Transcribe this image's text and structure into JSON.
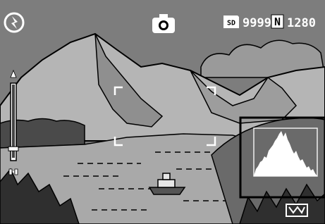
{
  "status_bar": {
    "flash_mode_icon": "flash-off-icon",
    "mode_icon": "camera-icon",
    "storage_badge": "SD",
    "shots_remaining": "9999",
    "quality_badge": "N",
    "image_size": "1280"
  },
  "zoom": {
    "top_icon": "tele-icon",
    "bottom_icon": "wide-icon",
    "level": 0.1
  },
  "histogram": {
    "visible": true
  },
  "bottom_right_icon": "camera-shake-icon",
  "colors": {
    "sky": "#808080",
    "mountains": "#b8b8b8",
    "hud": "#ffffff",
    "outline": "#000000"
  }
}
